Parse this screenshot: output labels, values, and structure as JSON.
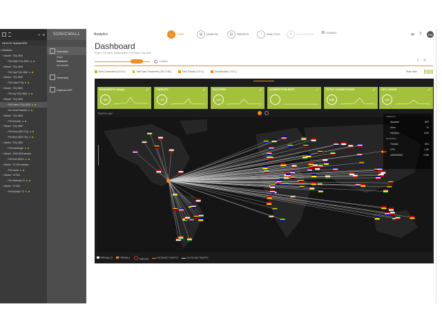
{
  "left_panel": {
    "header_label": "DEVICE MANAGER",
    "title": "Multisites",
    "items": [
      "Multisites",
      "Model : TZ/y 2600",
      "FM Kekki TZ/y 2600",
      "Model : TZ/y 2600",
      "FM Ygot TZ/y 2600",
      "Model : TZ/y 2600",
      "FM Cobre TZ/y",
      "Model : TZ/y 2600",
      "FM Irup TZ/y 2600",
      "Model : TZ/y 2600",
      "FM Pollvor TZ/y 2600",
      "NI Carnet Reabbin",
      "Model : TZ/y 2600",
      "FM Kreemib",
      "Model : TZ/y 2600",
      "FM Kehh 1800 TZ/y",
      "FM Illi/oi 1800 TZ/y",
      "Model : TZ/y 1800",
      "FM Anchorage",
      "Model : 1009 3218 wircles",
      "FM Kohl 1800 s",
      "Model : TZ 300 wireless",
      "FM Landa",
      "Model : TZ 300",
      "FM Gaaheab TZ",
      "Model : TZ 300",
      "FM Mixelbur TZ"
    ]
  },
  "nav_panel": {
    "logo": "SONICWALL",
    "sections": [
      {
        "label": "Overview",
        "subs": [
          "Status",
          "Dashboard",
          "Live Monitor"
        ]
      },
      {
        "label": "Summary",
        "subs": []
      },
      {
        "label": "Capture ATP",
        "subs": []
      }
    ]
  },
  "topbar": {
    "app_title": "Analytics",
    "nav": [
      {
        "label": "HOME",
        "icon": "home-icon",
        "state": "active"
      },
      {
        "label": "MONITOR",
        "icon": "monitor-icon",
        "state": "normal"
      },
      {
        "label": "REPORTS",
        "icon": "reports-icon",
        "state": "normal"
      },
      {
        "label": "ANALYTICS",
        "icon": "analytics-icon",
        "state": "normal"
      },
      {
        "label": "MANAGEMENT",
        "icon": "management-icon",
        "state": "disabled"
      },
      {
        "label": "DOMAIN",
        "icon": "domain-icon",
        "state": "normal"
      }
    ],
    "avatar_text": "PM"
  },
  "dashboard": {
    "title": "Dashboard",
    "breadcrumb": "Smart > FM Home: DashboardFill > FM Pollvor TZ/y 2600",
    "timeline_label": "Custom",
    "stats": [
      {
        "label": "Total Connections",
        "value": "[ 8.3 M ]",
        "color": "#a3c13a"
      },
      {
        "label": "Total Data Transferred",
        "value": "[ 332.3 GB ]",
        "color": "#a3c13a"
      },
      {
        "label": "Total Threats",
        "value": "[ 0.5 K ]",
        "color": "#f28c1e"
      },
      {
        "label": "Total Blocked",
        "value": "[ 2.3 K ]",
        "color": "#f28c1e"
      }
    ],
    "peak_label": "Peak index"
  },
  "cards": [
    {
      "title": "BANDWIDTH (Kbps)",
      "value": "151"
    },
    {
      "title": "THREATS",
      "value": "1.8"
    },
    {
      "title": "BLOCKED",
      "value": "<1%"
    },
    {
      "title": "CONNECTION RATE",
      "value": "↓"
    },
    {
      "title": "TOTAL CONNECTIONS",
      "value": "8.3M"
    },
    {
      "title": "CPU USAGE",
      "value": "<1%"
    }
  ],
  "map": {
    "label": "TRAFFIC MAP",
    "side_stats": [
      {
        "label": "Spyware",
        "value": "887"
      },
      {
        "label": "Virus",
        "value": "11"
      },
      {
        "label": "Intrusion",
        "value": "5.6K"
      },
      {
        "label": "Threats",
        "value": "891"
      },
      {
        "label": "CFS",
        "value": "1.5K"
      },
      {
        "label": "UNKNOWN",
        "value": "0.5M"
      }
    ],
    "side_heading": "THREATS",
    "side_heading2": "BLOCKED",
    "legend": [
      {
        "label": "FIREWALLS",
        "color": "#ffffff"
      },
      {
        "label": "FIREWALL",
        "color": "#f28c1e"
      },
      {
        "label": "THREATS",
        "color": "#d33"
      },
      {
        "label": "INCOMING TRAFFIC",
        "color": "#f28c1e"
      },
      {
        "label": "OUTGOING TRAFFIC",
        "color": "#dddddd"
      }
    ]
  }
}
